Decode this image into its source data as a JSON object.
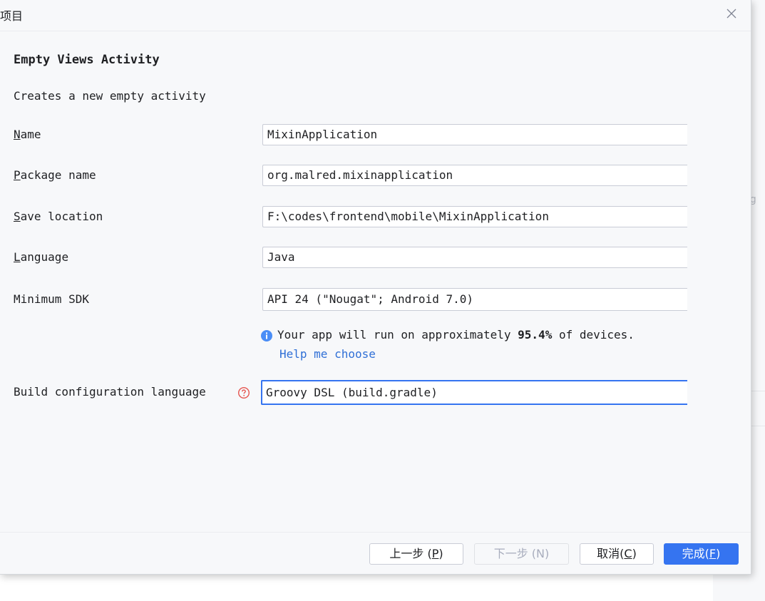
{
  "dialog": {
    "title": "建项目",
    "template_name": "Empty Views Activity",
    "template_description": "Creates a new empty activity"
  },
  "background": {
    "partial_text": "ıg"
  },
  "form": {
    "name": {
      "label_mnemonic": "N",
      "label_rest": "ame",
      "value": "MixinApplication"
    },
    "package_name": {
      "label_mnemonic": "P",
      "label_rest": "ackage name",
      "value": "org.malred.mixinapplication"
    },
    "save_location": {
      "label_mnemonic": "S",
      "label_rest": "ave location",
      "value": "F:\\codes\\frontend\\mobile\\MixinApplication"
    },
    "language": {
      "label_mnemonic": "L",
      "label_rest": "anguage",
      "value": "Java"
    },
    "minimum_sdk": {
      "label": "Minimum SDK",
      "value": "API 24 (\"Nougat\"; Android 7.0)"
    },
    "sdk_info": {
      "prefix": "Your app will run on approximately ",
      "percent": "95.4%",
      "suffix": " of devices.",
      "help_link": "Help me choose"
    },
    "build_config": {
      "label": "Build configuration language",
      "value": "Groovy DSL (build.gradle)"
    }
  },
  "buttons": {
    "previous": {
      "text": "上一步 (",
      "mnemonic": "P",
      "close": ")"
    },
    "next": {
      "text": "下一步 (N)"
    },
    "cancel": {
      "text": "取消(",
      "mnemonic": "C",
      "close": ")"
    },
    "finish": {
      "text": "完成(",
      "mnemonic": "F",
      "close": ")"
    }
  },
  "colors": {
    "accent": "#3574f0",
    "link": "#2f6fd6",
    "info_icon": "#4a8df6",
    "help_icon": "#e5554f"
  }
}
